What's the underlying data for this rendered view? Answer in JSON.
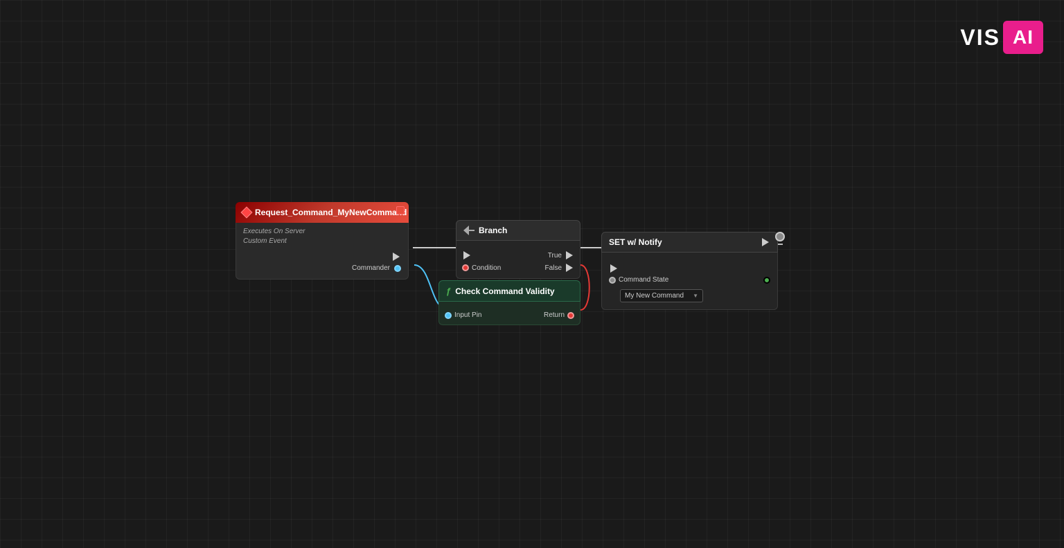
{
  "logo": {
    "text": "VIS",
    "box": "AI"
  },
  "nodes": {
    "request": {
      "title": "Request_Command_MyNewCommand",
      "subtitle_line1": "Executes On Server",
      "subtitle_line2": "Custom Event",
      "output_pin": "Commander"
    },
    "branch": {
      "title": "Branch",
      "input_exec": "",
      "input_condition": "Condition",
      "output_true": "True",
      "output_false": "False"
    },
    "check": {
      "title": "Check Command Validity",
      "input_pin": "Input Pin",
      "output_return": "Return"
    },
    "set": {
      "title": "SET w/ Notify",
      "field_label": "Command State",
      "dropdown_value": "My New Command"
    }
  },
  "colors": {
    "accent_pink": "#e91e8c",
    "exec_wire": "#cccccc",
    "blue_wire": "#4fc3f7",
    "red_wire": "#e53935",
    "green_wire": "#4caf50",
    "node_dark": "#252525",
    "node_border": "#3a3a3a"
  }
}
